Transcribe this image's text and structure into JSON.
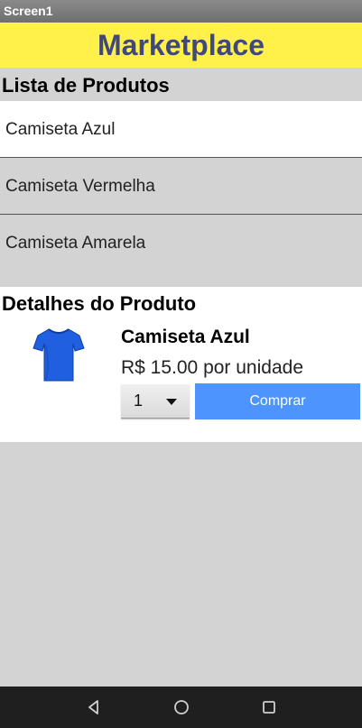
{
  "window": {
    "title": "Screen1"
  },
  "header": {
    "title": "Marketplace"
  },
  "list": {
    "label": "Lista de Produtos",
    "items": [
      "Camiseta Azul",
      "Camiseta Vermelha",
      "Camiseta Amarela"
    ],
    "selected_index": 0
  },
  "details": {
    "label": "Detalhes do Produto",
    "product_name": "Camiseta Azul",
    "price": "R$ 15.00 por unidade",
    "image_icon": "tshirt-icon",
    "shirt_color": "#1f5fe0",
    "quantity": {
      "value": "1"
    },
    "buy_label": "Comprar"
  },
  "colors": {
    "header_bg": "#fff04a",
    "header_text": "#3f4a7a",
    "button_bg": "#4d94ff",
    "background": "#d3d3d3"
  },
  "navbar": {
    "icons": [
      "back-icon",
      "home-icon",
      "recents-icon"
    ]
  }
}
